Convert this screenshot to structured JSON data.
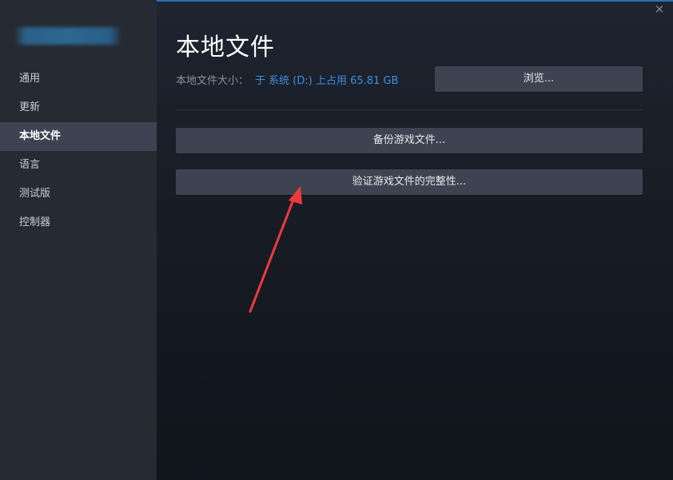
{
  "window": {
    "close_icon": "×"
  },
  "sidebar": {
    "items": [
      {
        "label": "通用"
      },
      {
        "label": "更新"
      },
      {
        "label": "本地文件"
      },
      {
        "label": "语言"
      },
      {
        "label": "测试版"
      },
      {
        "label": "控制器"
      }
    ],
    "active_index": 2
  },
  "main": {
    "title": "本地文件",
    "size_label": "本地文件大小：",
    "size_value": "于 系统 (D:) 上占用 65.81 GB",
    "browse_button": "浏览...",
    "backup_button": "备份游戏文件...",
    "verify_button": "验证游戏文件的完整性..."
  },
  "colors": {
    "accent_link": "#3f8ee0",
    "annotation_arrow": "#ee3a3a"
  }
}
